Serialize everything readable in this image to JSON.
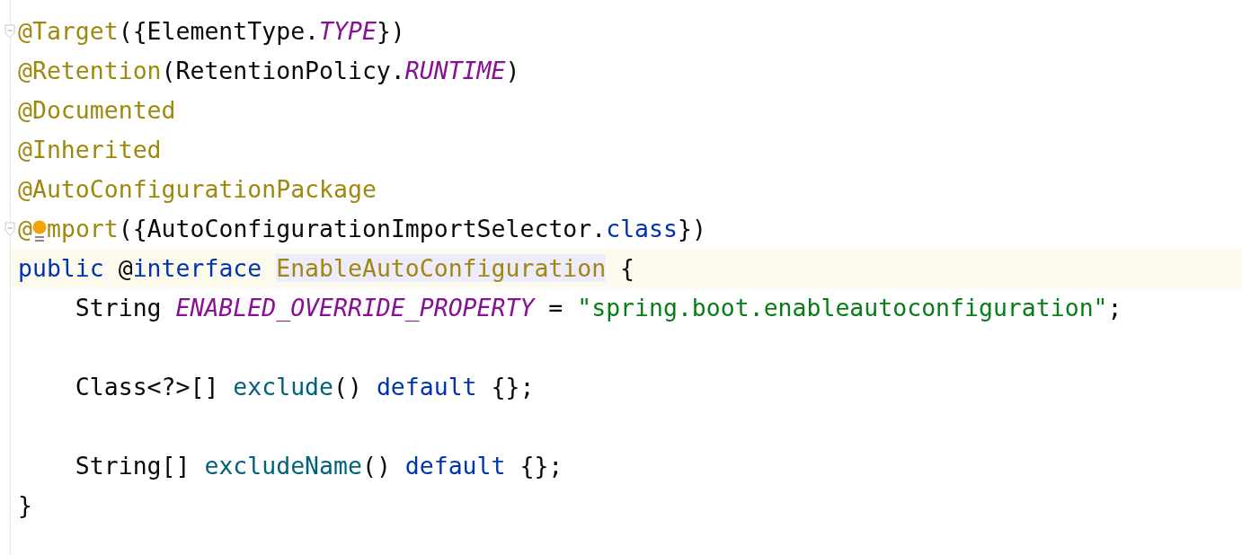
{
  "editor": {
    "lines": [
      {
        "fold": true,
        "current": false,
        "tokens": [
          {
            "text": "@Target",
            "kind": "annotation"
          },
          {
            "text": "({ElementType.",
            "kind": "plain"
          },
          {
            "text": "TYPE",
            "kind": "constant"
          },
          {
            "text": "})",
            "kind": "plain"
          }
        ]
      },
      {
        "current": false,
        "tokens": [
          {
            "text": "@Retention",
            "kind": "annotation"
          },
          {
            "text": "(RetentionPolicy.",
            "kind": "plain"
          },
          {
            "text": "RUNTIME",
            "kind": "constant"
          },
          {
            "text": ")",
            "kind": "plain"
          }
        ]
      },
      {
        "current": false,
        "tokens": [
          {
            "text": "@Documented",
            "kind": "annotation"
          }
        ]
      },
      {
        "current": false,
        "tokens": [
          {
            "text": "@Inherited",
            "kind": "annotation"
          }
        ]
      },
      {
        "current": false,
        "tokens": [
          {
            "text": "@AutoConfigurationPackage",
            "kind": "annotation"
          }
        ]
      },
      {
        "fold": true,
        "current": false,
        "tokens": [
          {
            "text": "@",
            "kind": "annotation"
          },
          {
            "kind": "bulb"
          },
          {
            "text": "mport",
            "kind": "annotation"
          },
          {
            "text": "({AutoConfigurationImportSelector.",
            "kind": "plain"
          },
          {
            "text": "class",
            "kind": "keyword"
          },
          {
            "text": "})",
            "kind": "plain"
          }
        ]
      },
      {
        "current": true,
        "tokens": [
          {
            "text": "public ",
            "kind": "keyword"
          },
          {
            "text": "@",
            "kind": "plain"
          },
          {
            "text": "interface ",
            "kind": "keyword"
          },
          {
            "text": "EnableAutoConfiguration",
            "kind": "annotation",
            "highlighted": true
          },
          {
            "text": " {",
            "kind": "plain"
          }
        ]
      },
      {
        "current": false,
        "tokens": [
          {
            "text": "    String ",
            "kind": "plain"
          },
          {
            "text": "ENABLED_OVERRIDE_PROPERTY",
            "kind": "constant"
          },
          {
            "text": " = ",
            "kind": "plain"
          },
          {
            "text": "\"spring.boot.enableautoconfiguration\"",
            "kind": "string"
          },
          {
            "text": ";",
            "kind": "plain"
          }
        ]
      },
      {
        "current": false
      },
      {
        "current": false,
        "tokens": [
          {
            "text": "    Class<?>[] ",
            "kind": "plain"
          },
          {
            "text": "exclude",
            "kind": "method"
          },
          {
            "text": "() ",
            "kind": "plain"
          },
          {
            "text": "default ",
            "kind": "keyword"
          },
          {
            "text": "{};",
            "kind": "plain"
          }
        ]
      },
      {
        "current": false
      },
      {
        "current": false,
        "tokens": [
          {
            "text": "    String[] ",
            "kind": "plain"
          },
          {
            "text": "excludeName",
            "kind": "method"
          },
          {
            "text": "() ",
            "kind": "plain"
          },
          {
            "text": "default ",
            "kind": "keyword"
          },
          {
            "text": "{};",
            "kind": "plain"
          }
        ]
      },
      {
        "current": false,
        "tokens": [
          {
            "text": "}",
            "kind": "plain"
          }
        ]
      }
    ]
  }
}
